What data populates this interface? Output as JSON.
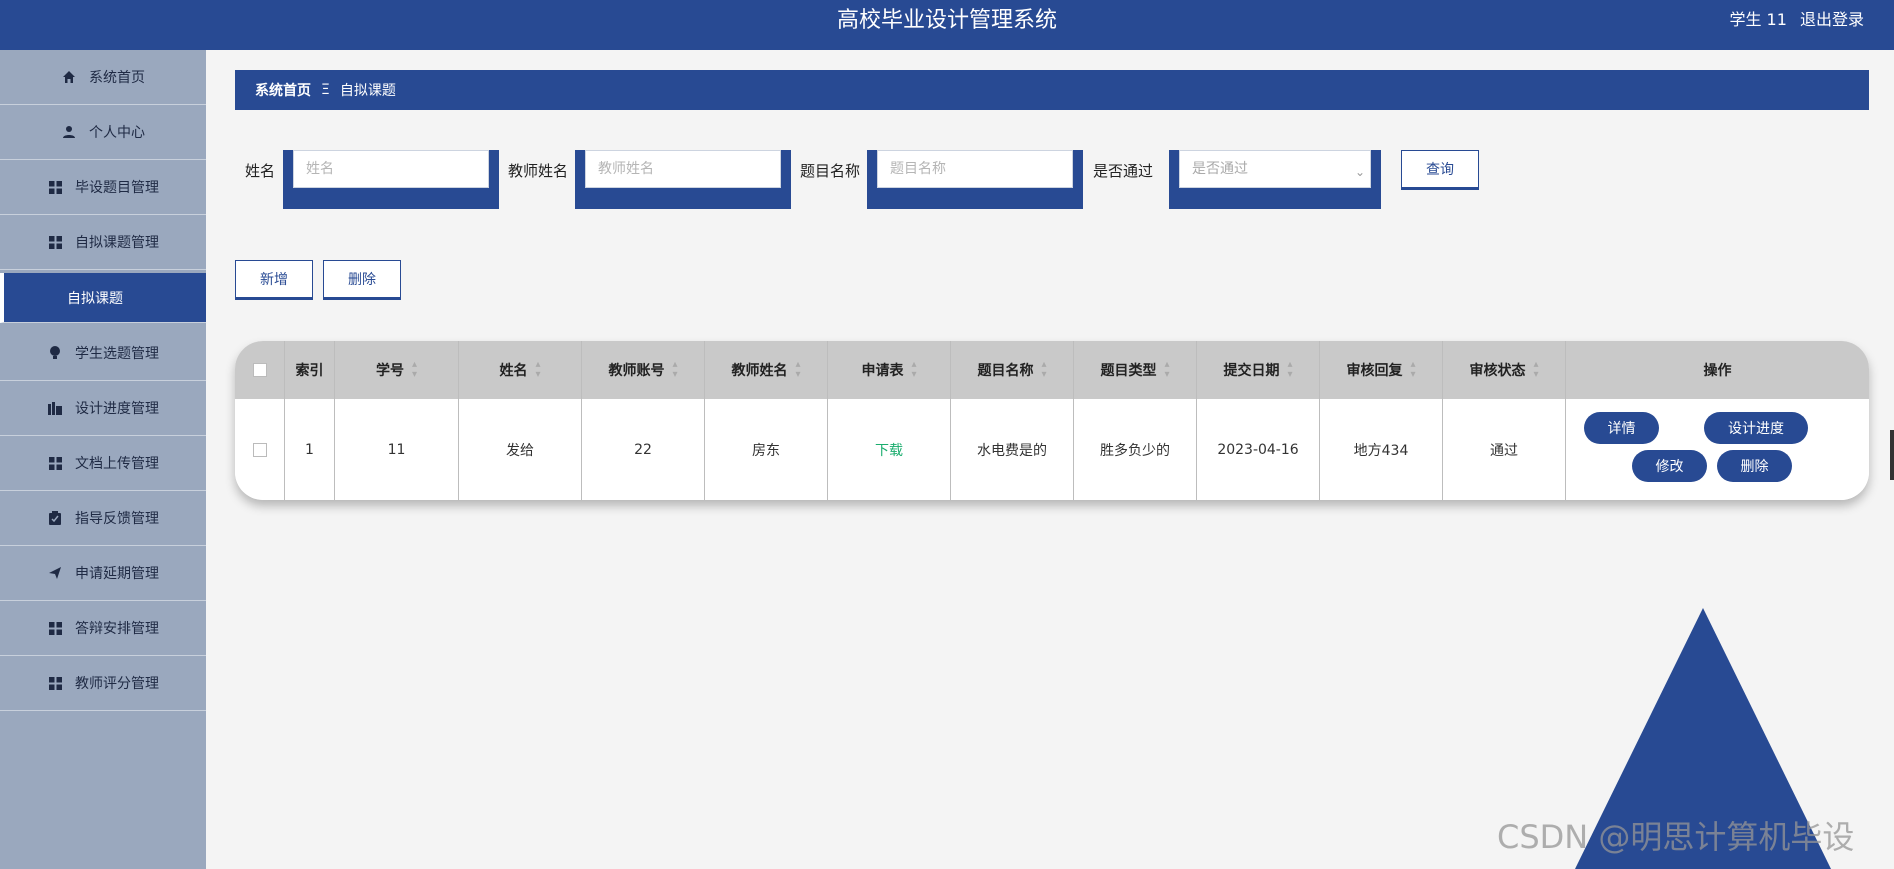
{
  "header": {
    "title": "高校毕业设计管理系统",
    "user": "学生 11",
    "logout": "退出登录"
  },
  "sidebar": {
    "items": [
      {
        "label": "系统首页",
        "icon": "home-icon"
      },
      {
        "label": "个人中心",
        "icon": "user-icon"
      },
      {
        "label": "毕设题目管理",
        "icon": "grid-icon"
      },
      {
        "label": "自拟课题管理",
        "icon": "grid-icon"
      },
      {
        "label": "自拟课题",
        "icon": ""
      },
      {
        "label": "学生选题管理",
        "icon": "bulb-icon"
      },
      {
        "label": "设计进度管理",
        "icon": "progress-icon"
      },
      {
        "label": "文档上传管理",
        "icon": "grid-icon"
      },
      {
        "label": "指导反馈管理",
        "icon": "clipboard-icon"
      },
      {
        "label": "申请延期管理",
        "icon": "send-icon"
      },
      {
        "label": "答辩安排管理",
        "icon": "grid-icon"
      },
      {
        "label": "教师评分管理",
        "icon": "grid-icon"
      }
    ]
  },
  "breadcrumb": {
    "home": "系统首页",
    "sep": "Ξ",
    "current": "自拟课题"
  },
  "search": {
    "name_label": "姓名",
    "name_placeholder": "姓名",
    "teacher_label": "教师姓名",
    "teacher_placeholder": "教师姓名",
    "topic_label": "题目名称",
    "topic_placeholder": "题目名称",
    "pass_label": "是否通过",
    "pass_placeholder": "是否通过",
    "query_button": "查询"
  },
  "actions": {
    "add": "新增",
    "delete": "删除"
  },
  "table": {
    "headers": [
      "索引",
      "学号",
      "姓名",
      "教师账号",
      "教师姓名",
      "申请表",
      "题目名称",
      "题目类型",
      "提交日期",
      "审核回复",
      "审核状态",
      "操作"
    ],
    "row": {
      "index": "1",
      "student_no": "11",
      "name": "发给",
      "teacher_account": "22",
      "teacher_name": "房东",
      "application": "下载",
      "topic": "水电费是的",
      "topic_type": "胜多负少的",
      "date": "2023-04-16",
      "reply": "地方434",
      "status": "通过"
    },
    "row_actions": {
      "detail": "详情",
      "progress": "设计进度",
      "edit": "修改",
      "delete": "删除"
    }
  },
  "watermark": "CSDN @明思计算机毕设",
  "colors": {
    "primary": "#284a93",
    "sidebar": "#9aa8be",
    "link": "#1aad6e"
  }
}
